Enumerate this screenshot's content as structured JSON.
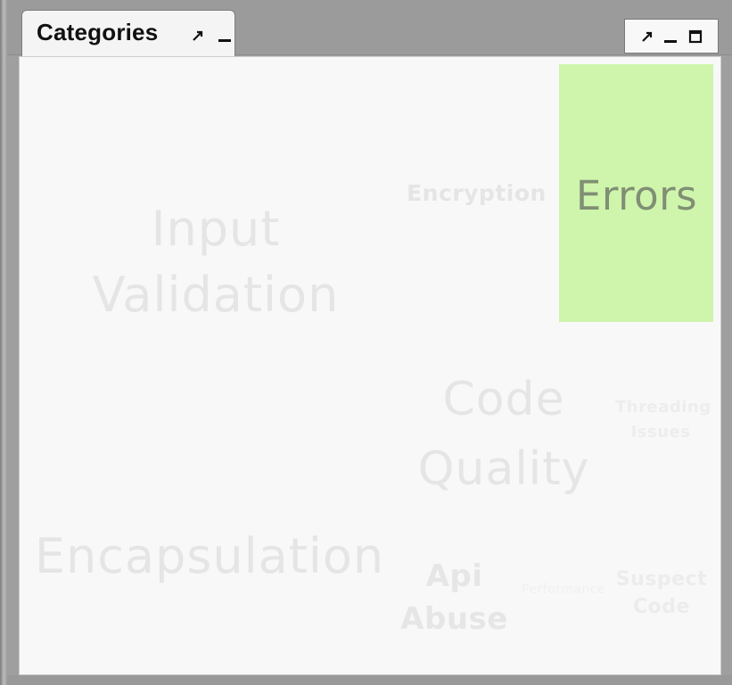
{
  "window": {
    "tab_title": "Categories"
  },
  "icons": {
    "tab_maximize": "diagonal-arrow-icon",
    "tab_minimize": "minimize-icon",
    "panel_maximize": "diagonal-arrow-icon",
    "panel_minimize": "minimize-icon",
    "panel_restore": "square-icon"
  },
  "categories": [
    {
      "label": "Errors",
      "highlighted": true
    },
    {
      "label": "Encryption"
    },
    {
      "label": "Input Validation"
    },
    {
      "label": "Code Quality"
    },
    {
      "label": "Threading Issues"
    },
    {
      "label": "Encapsulation"
    },
    {
      "label": "Api Abuse"
    },
    {
      "label": "Performance"
    },
    {
      "label": "Suspect Code"
    }
  ],
  "colors": {
    "highlight_fill": "#cff5ac",
    "highlight_text": "#808f74",
    "muted_text": "#e5e5e5",
    "panel_bg": "#f8f8f8",
    "frame_bg": "#9f9f9f"
  }
}
